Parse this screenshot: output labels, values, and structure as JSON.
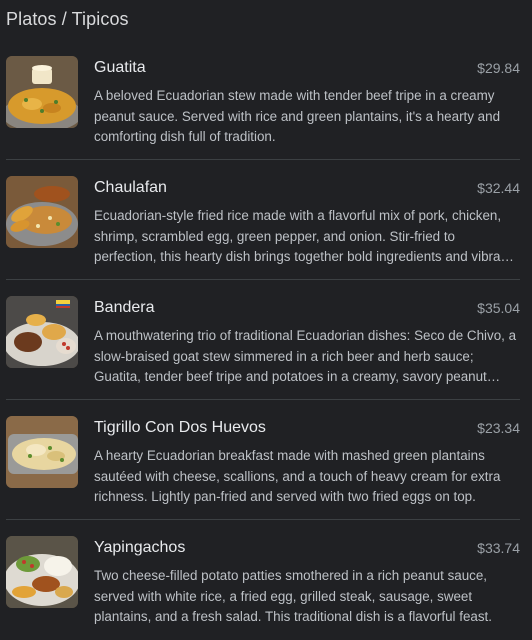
{
  "section": {
    "title": "Platos / Tipicos"
  },
  "items": [
    {
      "name": "Guatita",
      "price": "$29.84",
      "description": "A beloved Ecuadorian stew made with tender beef tripe in a creamy peanut sauce. Served with rice and green plantains, it's a hearty and comforting dish full of tradition.",
      "image_icon": "guatita-dish-photo"
    },
    {
      "name": "Chaulafan",
      "price": "$32.44",
      "description": "Ecuadorian-style fried rice made with a flavorful mix of pork, chicken, shrimp, scrambled egg, green pepper, and onion. Stir-fried to perfection, this hearty dish brings together bold ingredients and vibrant flavors.",
      "image_icon": "chaulafan-dish-photo"
    },
    {
      "name": "Bandera",
      "price": "$35.04",
      "description": "A mouthwatering trio of traditional Ecuadorian dishes: Seco de Chivo, a slow-braised goat stew simmered in a rich beer and herb sauce; Guatita, tender beef tripe and potatoes in a creamy, savory peanut sauce.",
      "image_icon": "bandera-dish-photo"
    },
    {
      "name": "Tigrillo Con Dos Huevos",
      "price": "$23.34",
      "description": "A hearty Ecuadorian breakfast made with mashed green plantains sautéed with cheese, scallions, and a touch of heavy cream for extra richness. Lightly pan-fried and served with two fried eggs on top.",
      "image_icon": "tigrillo-dish-photo"
    },
    {
      "name": "Yapingachos",
      "price": "$33.74",
      "description": "Two cheese-filled potato patties smothered in a rich peanut sauce, served with white rice, a fried egg, grilled steak, sausage, sweet plantains, and a fresh salad. This traditional dish is a flavorful feast.",
      "image_icon": "yapingachos-dish-photo"
    }
  ]
}
